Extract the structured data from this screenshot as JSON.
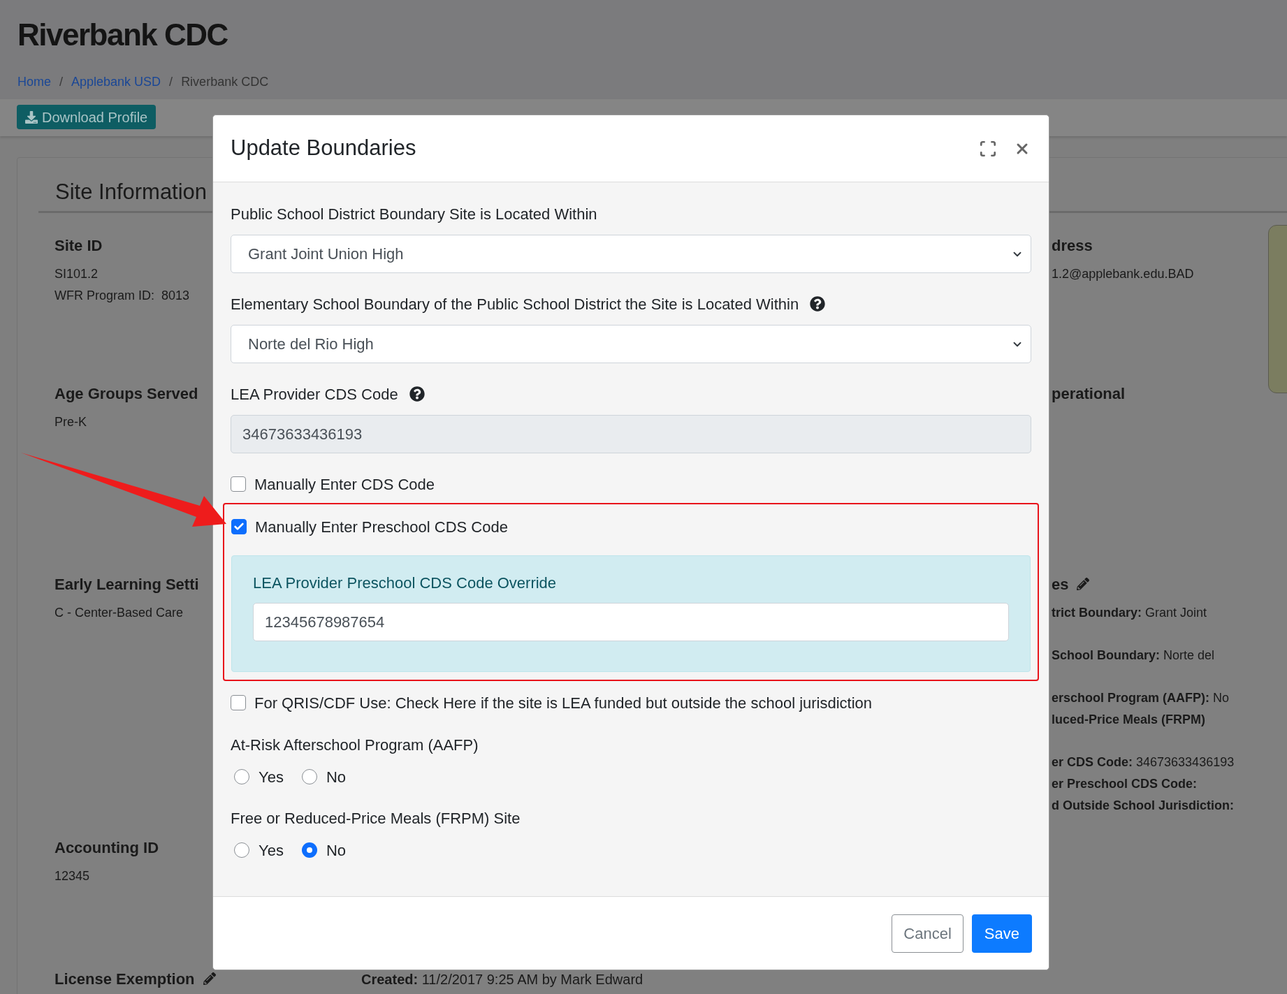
{
  "page": {
    "title": "Riverbank CDC",
    "breadcrumb": [
      {
        "label": "Home",
        "kind": "link"
      },
      {
        "label": "/",
        "kind": "separator"
      },
      {
        "label": "Applebank USD",
        "kind": "link"
      },
      {
        "label": "/",
        "kind": "separator"
      },
      {
        "label": "Riverbank CDC",
        "kind": "current"
      }
    ],
    "download_button": "Download Profile",
    "card_title": "Site Information",
    "left_fields": [
      {
        "label": "Site ID",
        "lines": [
          "SI101.2",
          "WFR Program ID:  8013"
        ],
        "editable": false
      },
      {
        "label": "Age Groups Served",
        "lines": [
          "Pre-K"
        ],
        "editable": false
      },
      {
        "label": "Early Learning Setti",
        "lines": [
          "C - Center-Based Care"
        ],
        "editable": false
      },
      {
        "label": "Accounting ID",
        "lines": [
          "12345"
        ],
        "editable": false
      },
      {
        "label": "License Exemption",
        "editable": true
      }
    ],
    "created": {
      "label": "Created:",
      "value": "11/2/2017 9:25 AM by Mark Edward"
    },
    "right_fields": [
      {
        "label": "dress",
        "editable": false,
        "groups": [
          [
            {
              "value": "1.2@applebank.edu.BAD"
            }
          ]
        ]
      },
      {
        "label": "perational",
        "editable": false
      },
      {
        "label": "es",
        "editable": true,
        "groups": [
          [
            {
              "label": "trict Boundary:",
              "value": "Grant Joint"
            }
          ],
          [
            {
              "label": "School Boundary:",
              "value": "Norte del"
            }
          ],
          [
            {
              "label": "erschool Program (AAFP):",
              "value": "No"
            },
            {
              "label": "luced-Price Meals (FRPM)"
            }
          ],
          [
            {
              "label": "er CDS Code:",
              "value": "34673633436193"
            },
            {
              "label": "er Preschool CDS Code:"
            },
            {
              "label": "d Outside School Jurisdiction:"
            }
          ]
        ]
      }
    ]
  },
  "modal": {
    "title": "Update Boundaries",
    "fields": [
      {
        "kind": "select",
        "label": "Public School District Boundary Site is Located Within",
        "value": "Grant Joint Union High",
        "help": false
      },
      {
        "kind": "select",
        "label": "Elementary School Boundary of the Public School District the Site is Located Within",
        "value": "Norte del Rio High",
        "help": true
      },
      {
        "kind": "readonly",
        "label": "LEA Provider CDS Code",
        "value": "34673633436193",
        "help": true
      },
      {
        "kind": "checkbox",
        "label": "Manually Enter CDS Code",
        "checked": false,
        "highlighted": false
      },
      {
        "kind": "checkbox",
        "label": "Manually Enter Preschool CDS Code",
        "checked": true,
        "highlighted": true,
        "override": {
          "label": "LEA Provider Preschool CDS Code Override",
          "value": "12345678987654"
        }
      },
      {
        "kind": "checkbox",
        "label": "For QRIS/CDF Use: Check Here if the site is LEA funded but outside the school jurisdiction",
        "checked": false,
        "highlighted": false
      },
      {
        "kind": "radio",
        "label": "At-Risk Afterschool Program (AAFP)",
        "options": [
          {
            "label": "Yes",
            "selected": false
          },
          {
            "label": "No",
            "selected": false
          }
        ]
      },
      {
        "kind": "radio",
        "label": "Free or Reduced-Price Meals (FRPM) Site",
        "options": [
          {
            "label": "Yes",
            "selected": false
          },
          {
            "label": "No",
            "selected": true
          }
        ]
      }
    ],
    "buttons": [
      {
        "label": "Cancel",
        "kind": "secondary"
      },
      {
        "label": "Save",
        "kind": "primary"
      }
    ]
  }
}
